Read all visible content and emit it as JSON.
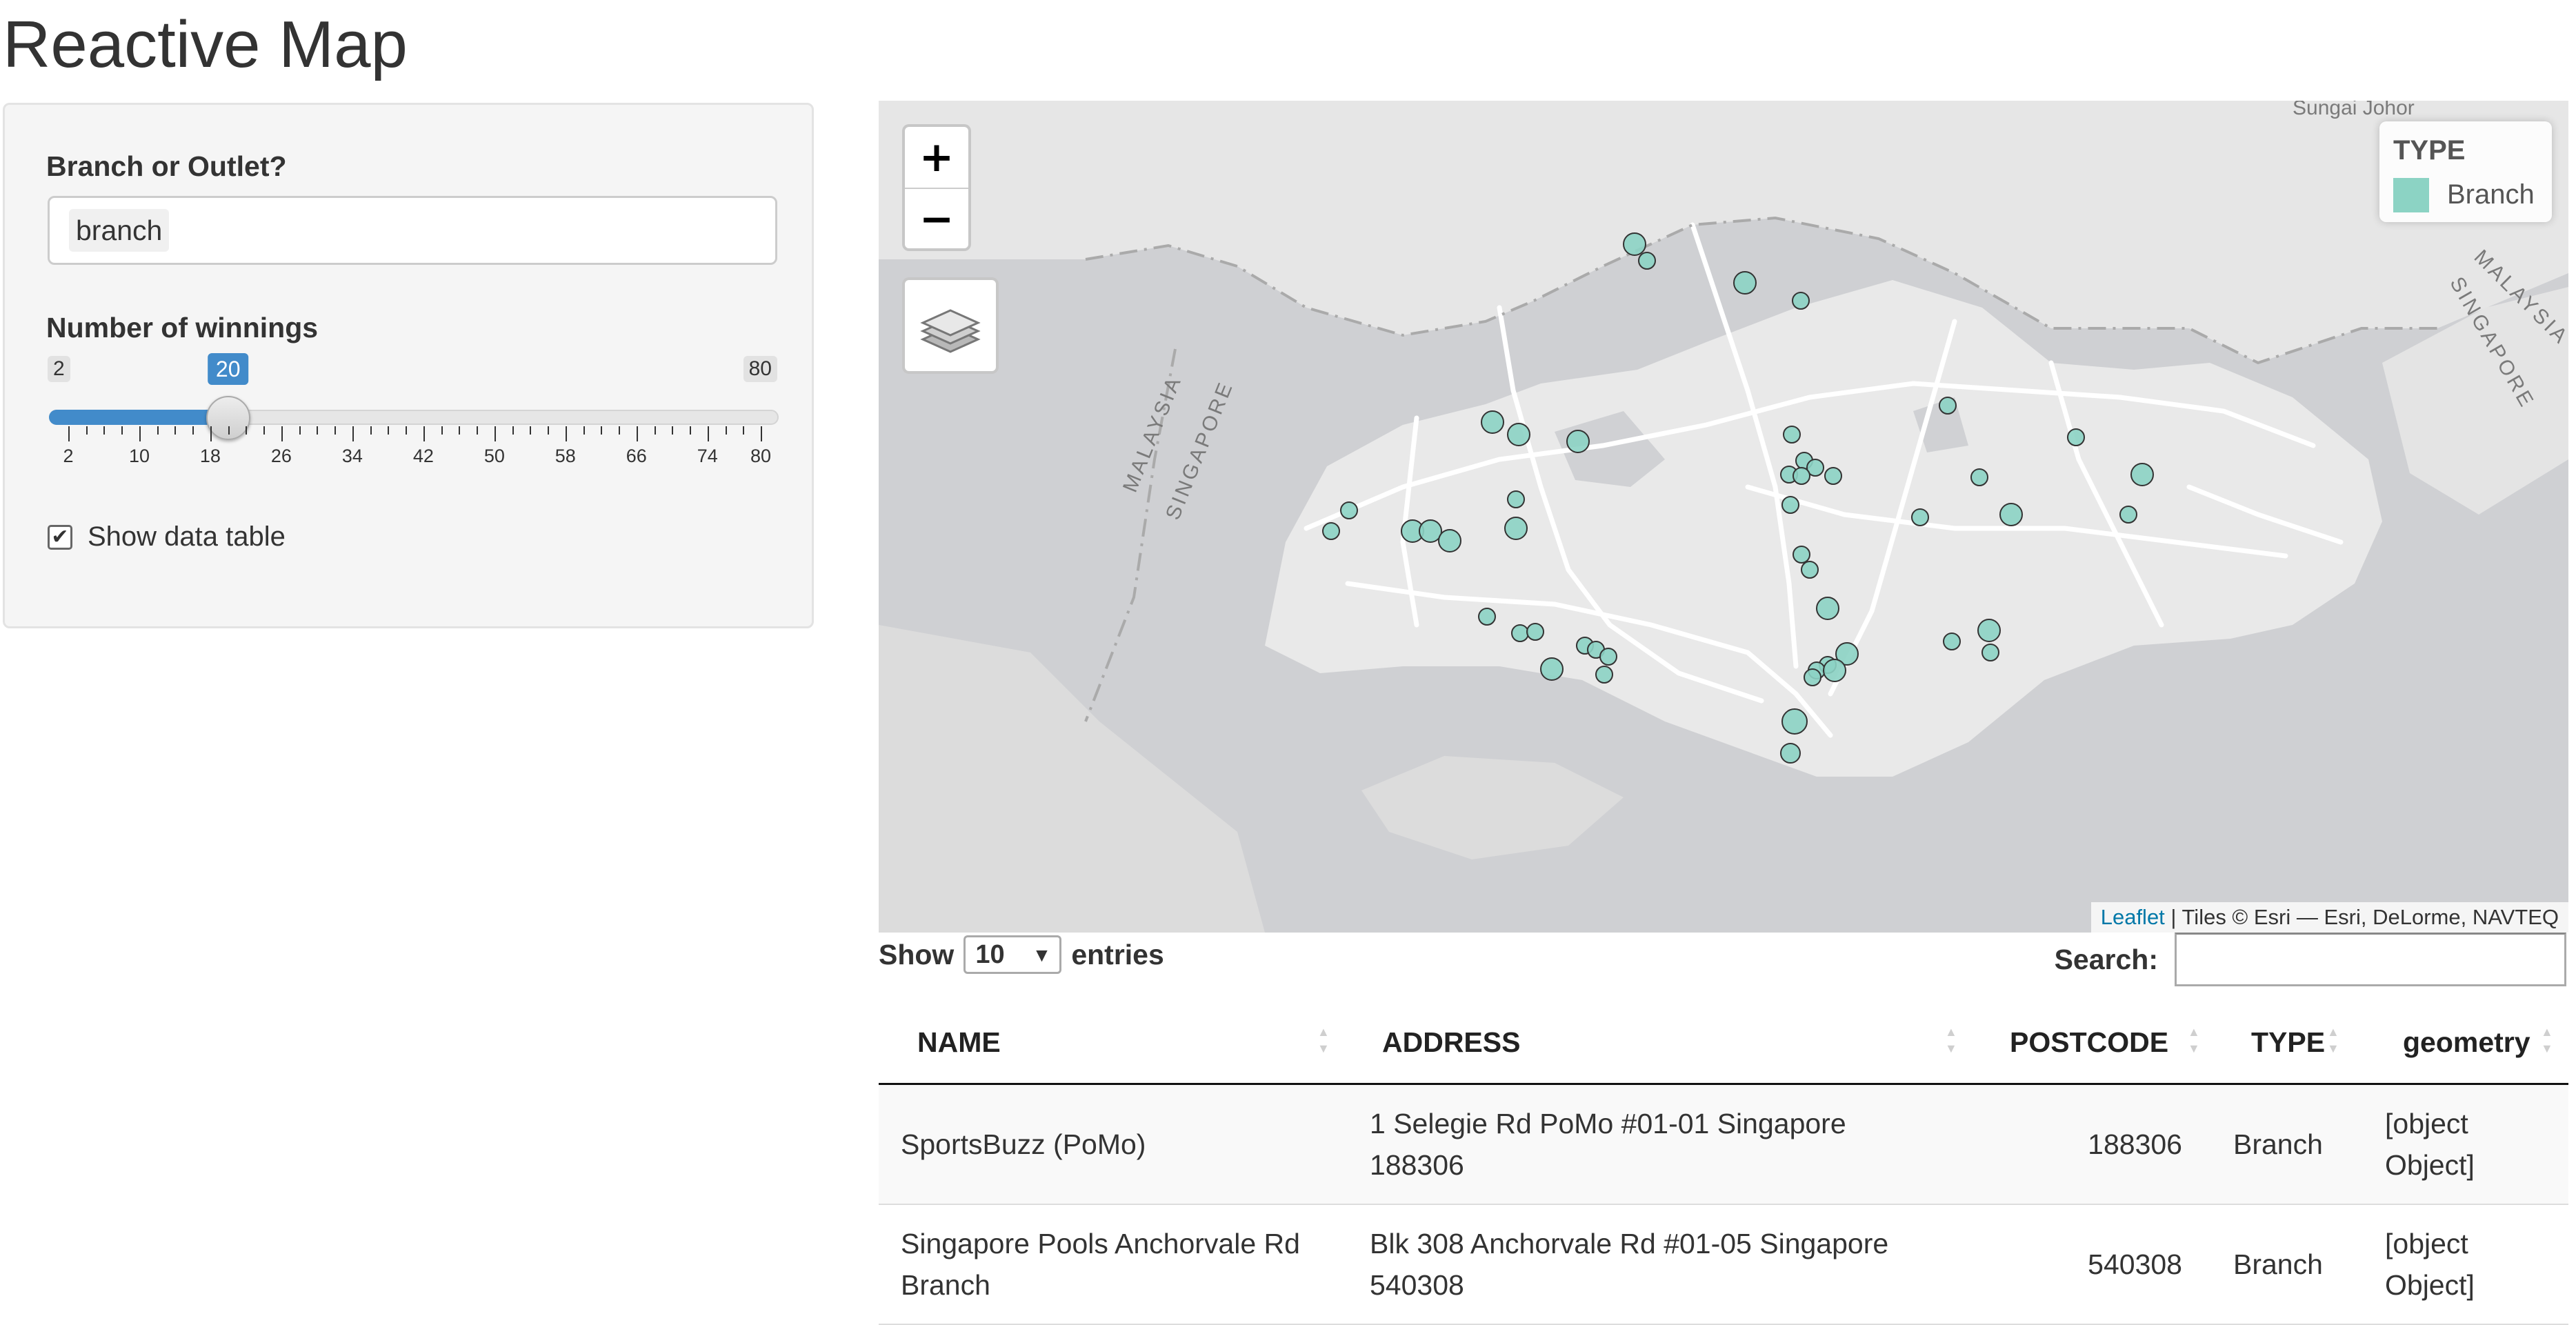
{
  "page": {
    "title": "Reactive Map"
  },
  "sidebar": {
    "type_label": "Branch or Outlet?",
    "type_value": "branch",
    "slider": {
      "label": "Number of winnings",
      "min": 2,
      "max": 80,
      "value": 20,
      "min_label": "2",
      "max_label": "80",
      "value_label": "20",
      "tick_labels": [
        "2",
        "10",
        "18",
        "26",
        "34",
        "42",
        "50",
        "58",
        "66",
        "74",
        "80"
      ]
    },
    "show_table_label": "Show data table",
    "show_table_checked": true
  },
  "map": {
    "zoom_in": "+",
    "zoom_out": "−",
    "layers_icon": "layers-icon",
    "legend_title": "TYPE",
    "legend_label": "Branch",
    "marker_color": "#8cd3c4",
    "attribution_link": "Leaflet",
    "attribution_text": " | Tiles © Esri — Esri, DeLorme, NAVTEQ",
    "label_malaysia_left": "MALAYSIA",
    "label_singapore_left": "SINGAPORE",
    "label_malaysia_right": "MALAYSIA",
    "label_singapore_right": "SINGAPORE",
    "label_top": "Sungai Johor"
  },
  "table": {
    "show_label": "Show",
    "length_value": "10",
    "entries_label": "entries",
    "search_label": "Search:",
    "columns": [
      "NAME",
      "ADDRESS",
      "POSTCODE",
      "TYPE",
      "geometry"
    ],
    "rows": [
      {
        "name_line1": "SportsBuzz (PoMo)",
        "name_line2": "",
        "address_line1": "1 Selegie Rd PoMo #01-01 Singapore",
        "address_line2": "188306",
        "postcode": "188306",
        "type": "Branch",
        "geometry_line1": "[object",
        "geometry_line2": "Object]"
      },
      {
        "name_line1": "Singapore Pools Anchorvale Rd",
        "name_line2": "Branch",
        "address_line1": "Blk 308 Anchorvale Rd #01-05 Singapore",
        "address_line2": "540308",
        "postcode": "540308",
        "type": "Branch",
        "geometry_line1": "[object",
        "geometry_line2": "Object]"
      }
    ]
  }
}
